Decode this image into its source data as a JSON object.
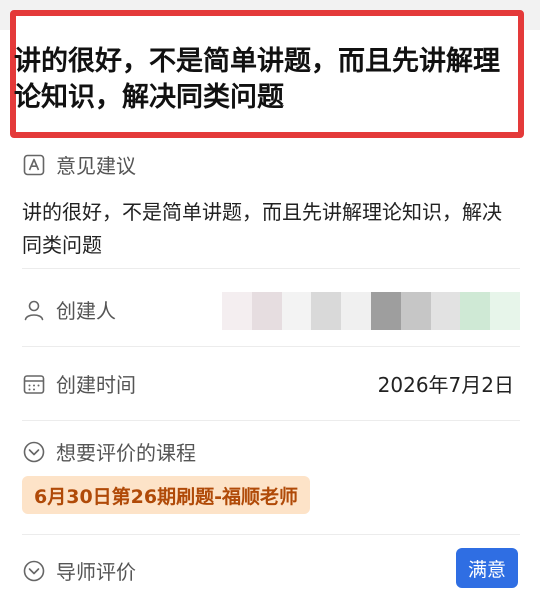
{
  "highlight": {
    "headline": "讲的很好，不是简单讲题，而且先讲解理论知识，解决同类问题"
  },
  "suggestion": {
    "label": "意见建议",
    "icon": "font-a-icon",
    "text": "讲的很好，不是简单讲题，而且先讲解理论知识，解决同类问题"
  },
  "creator": {
    "label": "创建人",
    "icon": "person-icon"
  },
  "created_time": {
    "label": "创建时间",
    "icon": "calendar-icon",
    "value": "2026年7月2日"
  },
  "course": {
    "label": "想要评价的课程",
    "icon": "chevron-down-circle-icon",
    "tag": "6月30日第26期刷题-福顺老师"
  },
  "tutor_rating": {
    "label": "导师评价",
    "icon": "chevron-down-circle-icon",
    "value": "满意"
  },
  "colors": {
    "highlight_border": "#e43a3a",
    "tag_bg": "#fde3c8",
    "tag_text": "#b04a08",
    "badge_bg": "#2f6ee3"
  }
}
